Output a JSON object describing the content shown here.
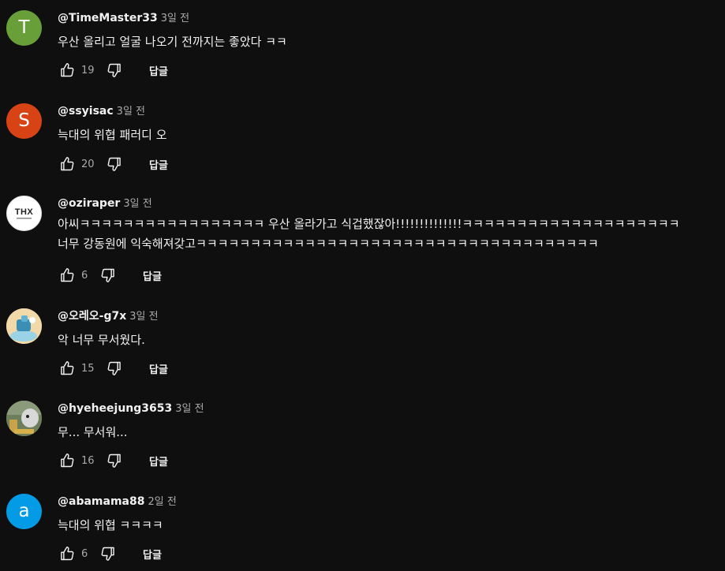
{
  "icons": {
    "like": "thumbs-up-icon",
    "dislike": "thumbs-down-icon"
  },
  "colors": {
    "background": "#0f0f0f",
    "text_primary": "#f1f1f1",
    "text_secondary": "#aaaaaa"
  },
  "comments": [
    {
      "author": "@TimeMaster33",
      "time": "3일 전",
      "text": "우산 올리고 얼굴 나오기 전까지는 좋았다 ㅋㅋ",
      "likes": "19",
      "reply_label": "답글",
      "avatar": {
        "type": "letter",
        "letter": "T",
        "color": "#689f38"
      }
    },
    {
      "author": "@ssyisac",
      "time": "3일 전",
      "text": "늑대의 위협 패러디 오",
      "likes": "20",
      "reply_label": "답글",
      "avatar": {
        "type": "letter",
        "letter": "S",
        "color": "#d84315"
      }
    },
    {
      "author": "@oziraper",
      "time": "3일 전",
      "text": "아씨ㅋㅋㅋㅋㅋㅋㅋㅋㅋㅋㅋㅋㅋㅋㅋㅋㅋ 우산 올라가고 식겁했잖아!!!!!!!!!!!!!!ㅋㅋㅋㅋㅋㅋㅋㅋㅋㅋㅋㅋㅋㅋㅋㅋㅋㅋㅋㅋ\n너무 강동원에 익숙해져갖고ㅋㅋㅋㅋㅋㅋㅋㅋㅋㅋㅋㅋㅋㅋㅋㅋㅋㅋㅋㅋㅋㅋㅋㅋㅋㅋㅋㅋㅋㅋㅋㅋㅋㅋㅋㅋㅋ",
      "likes": "6",
      "reply_label": "답글",
      "avatar": {
        "type": "logo",
        "logo_text": "THX",
        "color": "#ffffff"
      }
    },
    {
      "author": "@오레오-g7x",
      "time": "3일 전",
      "text": "악 너무 무서웠다.",
      "likes": "15",
      "reply_label": "답글",
      "avatar": {
        "type": "image",
        "icon": "cartoon-avatar-icon",
        "color": "#f2d9a8"
      }
    },
    {
      "author": "@hyeheejung3653",
      "time": "3일 전",
      "text": "무... 무서워...",
      "likes": "16",
      "reply_label": "답글",
      "avatar": {
        "type": "image",
        "icon": "photo-avatar-icon",
        "color": "#6d7f5a"
      }
    },
    {
      "author": "@abamama88",
      "time": "2일 전",
      "text": "늑대의 위협 ㅋㅋㅋㅋ",
      "likes": "6",
      "reply_label": "답글",
      "avatar": {
        "type": "letter",
        "letter": "a",
        "color": "#039be5"
      }
    }
  ]
}
